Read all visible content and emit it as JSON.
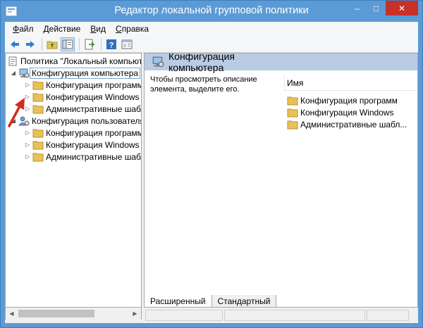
{
  "window": {
    "title": "Редактор локальной групповой политики",
    "controls": {
      "minimize": "–",
      "maximize": "□",
      "close": "✕"
    }
  },
  "menu": [
    {
      "underline": "Ф",
      "rest": "айл"
    },
    {
      "underline": "Д",
      "rest": "ействие"
    },
    {
      "underline": "В",
      "rest": "ид"
    },
    {
      "underline": "С",
      "rest": "правка"
    }
  ],
  "toolbar": {
    "icons": [
      "back-arrow-icon",
      "forward-arrow-icon",
      "folder-up-icon",
      "show-hide-tree-icon",
      "export-list-icon",
      "help-icon",
      "properties-panel-icon"
    ]
  },
  "tree": {
    "root": "Политика \"Локальный компьютер\"",
    "computer": {
      "label": "Конфигурация компьютера",
      "children": [
        "Конфигурация программ",
        "Конфигурация Windows",
        "Административные шаблоны"
      ]
    },
    "user": {
      "label": "Конфигурация пользователя",
      "children": [
        "Конфигурация программ",
        "Конфигурация Windows",
        "Административные шаблоны"
      ]
    }
  },
  "content": {
    "header": "Конфигурация компьютера",
    "description": "Чтобы просмотреть описание элемента, выделите его.",
    "column_name": "Имя",
    "items": [
      "Конфигурация программ",
      "Конфигурация Windows",
      "Административные шабл..."
    ]
  },
  "tabs": [
    "Расширенный",
    "Стандартный"
  ],
  "colors": {
    "titlebar": "#5b9bd5",
    "close_button": "#c7312a",
    "content_header": "#b9cce4",
    "folder": "#e8c15a",
    "annotation_arrow": "#d42a1f"
  }
}
